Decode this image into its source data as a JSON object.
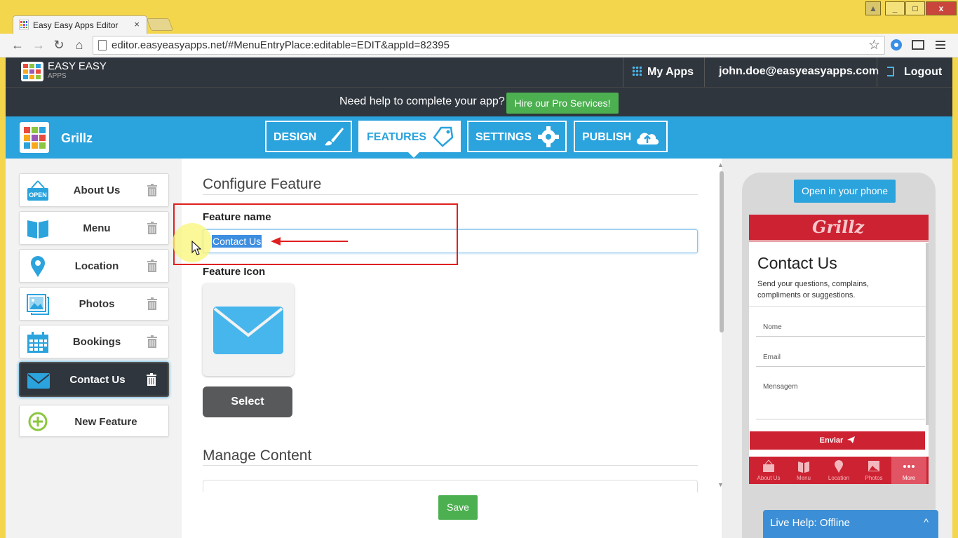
{
  "browser": {
    "tab_title": "Easy Easy Apps Editor",
    "tab_close": "×",
    "url": "editor.easyeasyapps.net/#MenuEntryPlace:editable=EDIT&appId=82395",
    "back": "←",
    "forward": "→",
    "reload": "↻",
    "home": "⌂",
    "star": "☆",
    "win_min": "_",
    "win_max": "□",
    "win_close": "x"
  },
  "header": {
    "logo_main": "EASY EASY",
    "logo_sub": "APPS",
    "my_apps": "My Apps",
    "user_email": "john.doe@easyeasyapps.com",
    "logout": "Logout"
  },
  "help_bar": {
    "text": "Need help to complete your app?",
    "button": "Hire our Pro Services!"
  },
  "appbar": {
    "app_name": "Grillz",
    "tabs": [
      {
        "label": "DESIGN"
      },
      {
        "label": "FEATURES"
      },
      {
        "label": "SETTINGS"
      },
      {
        "label": "PUBLISH"
      }
    ]
  },
  "sidebar": {
    "items": [
      {
        "label": "About Us",
        "icon": "open-sign-icon"
      },
      {
        "label": "Menu",
        "icon": "book-icon"
      },
      {
        "label": "Location",
        "icon": "map-pin-icon"
      },
      {
        "label": "Photos",
        "icon": "photos-icon"
      },
      {
        "label": "Bookings",
        "icon": "calendar-icon"
      },
      {
        "label": "Contact Us",
        "icon": "envelope-icon",
        "active": true
      }
    ],
    "new_feature": "New Feature"
  },
  "config": {
    "heading": "Configure Feature",
    "name_label": "Feature name",
    "name_value": "Contact Us",
    "icon_label": "Feature Icon",
    "select_button": "Select",
    "manage_heading": "Manage Content",
    "save_button": "Save"
  },
  "preview": {
    "open_button": "Open in your phone",
    "logo": "Grillz",
    "title": "Contact Us",
    "description": "Send your questions, complains, compliments or suggestions.",
    "fields": [
      "Nome",
      "Email",
      "Mensagem"
    ],
    "submit": "Enviar",
    "nav": [
      {
        "label": "About Us"
      },
      {
        "label": "Menu"
      },
      {
        "label": "Location"
      },
      {
        "label": "Photos"
      },
      {
        "label": "More",
        "active": true
      }
    ]
  },
  "live_help": {
    "text": "Live Help: Offline",
    "chevron": "^"
  },
  "colors": {
    "brand_blue": "#2ba3dd",
    "header_dark": "#2f363e",
    "accent_green": "#4caf50",
    "preview_red": "#cd2232",
    "annotation_red": "#e01f1f"
  }
}
